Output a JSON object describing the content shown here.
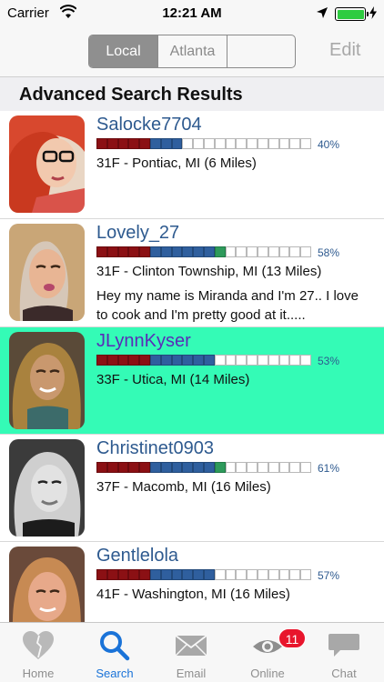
{
  "status_bar": {
    "carrier": "Carrier",
    "time": "12:21 AM"
  },
  "nav": {
    "segments": [
      "Local",
      "Atlanta",
      ""
    ],
    "edit_label": "Edit"
  },
  "section_title": "Advanced Search Results",
  "results": [
    {
      "username": "Salocke7704",
      "match_percent": 40,
      "match_label": "40%",
      "details": "31F - Pontiac, MI (6 Miles)",
      "about": "",
      "selected": false
    },
    {
      "username": "Lovely_27",
      "match_percent": 58,
      "match_label": "58%",
      "details": "31F - Clinton Township, MI (13 Miles)",
      "about": "Hey my name is Miranda and I'm 27.. I love to cook and I'm pretty good at it.....",
      "selected": false
    },
    {
      "username": "JLynnKyser",
      "match_percent": 53,
      "match_label": "53%",
      "details": "33F - Utica, MI (14 Miles)",
      "about": "",
      "selected": true
    },
    {
      "username": "Christinet0903",
      "match_percent": 61,
      "match_label": "61%",
      "details": "37F - Macomb, MI (16 Miles)",
      "about": "",
      "selected": false
    },
    {
      "username": "Gentlelola",
      "match_percent": 57,
      "match_label": "57%",
      "details": "41F - Washington, MI (16 Miles)",
      "about": "",
      "selected": false
    }
  ],
  "tabs": [
    {
      "label": "Home",
      "icon": "heart-icon",
      "active": false
    },
    {
      "label": "Search",
      "icon": "search-icon",
      "active": true
    },
    {
      "label": "Email",
      "icon": "envelope-icon",
      "active": false
    },
    {
      "label": "Online",
      "icon": "eye-icon",
      "active": false
    },
    {
      "label": "Chat",
      "icon": "chat-bubble-icon",
      "active": false
    }
  ],
  "online_badge": "11",
  "colors": {
    "selected_row": "#34fbb6",
    "username": "#2e5a8f",
    "tab_active": "#1a73d8",
    "badge": "#e8152c"
  }
}
